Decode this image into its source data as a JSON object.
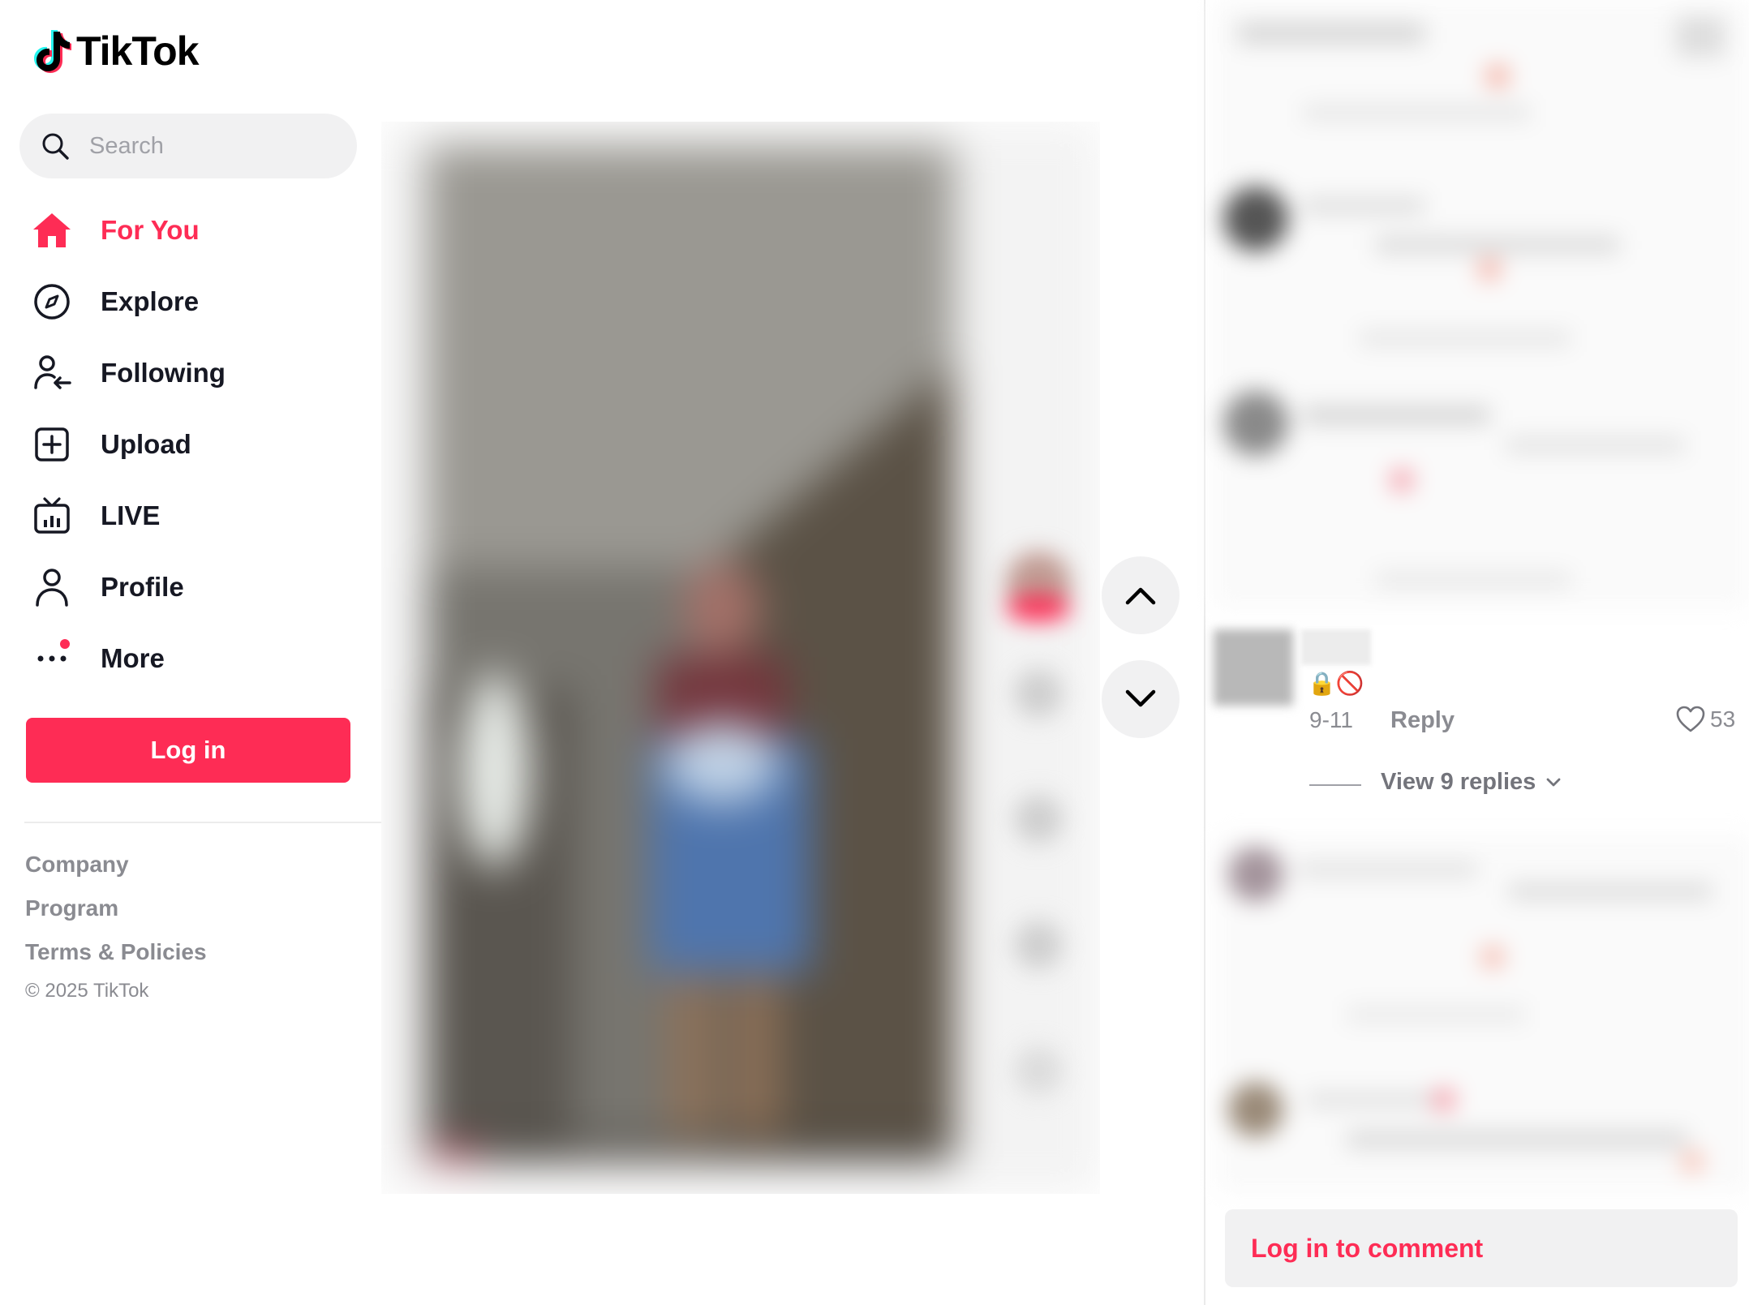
{
  "app": {
    "name": "TikTok"
  },
  "colors": {
    "accent": "#fe2c55",
    "text": "#161823",
    "muted": "#8a8b91",
    "surface": "#f1f1f2"
  },
  "search": {
    "placeholder": "Search",
    "icon": "search-icon"
  },
  "nav": [
    {
      "label": "For You",
      "icon": "home-icon",
      "active": true
    },
    {
      "label": "Explore",
      "icon": "compass-icon",
      "active": false
    },
    {
      "label": "Following",
      "icon": "following-icon",
      "active": false
    },
    {
      "label": "Upload",
      "icon": "upload-icon",
      "active": false
    },
    {
      "label": "LIVE",
      "icon": "live-icon",
      "active": false
    },
    {
      "label": "Profile",
      "icon": "profile-icon",
      "active": false
    },
    {
      "label": "More",
      "icon": "more-icon",
      "active": false,
      "badge": true
    }
  ],
  "login_button": "Log in",
  "footer": {
    "links": [
      "Company",
      "Program",
      "Terms & Policies"
    ],
    "copyright": "© 2025 TikTok"
  },
  "comment": {
    "emojis": "🔒🚫",
    "date": "9-11",
    "reply_label": "Reply",
    "likes": "53",
    "view_replies": "View 9 replies"
  },
  "comment_input": {
    "label": "Log in to comment"
  }
}
